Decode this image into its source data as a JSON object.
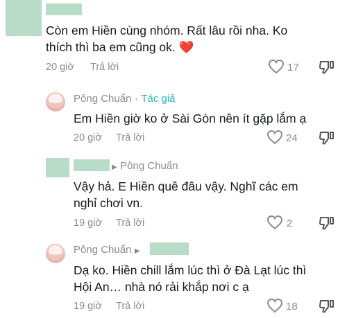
{
  "comments": [
    {
      "text_line1": "Còn em Hiền cùng nhóm. Rất lâu rồi nha. Ko",
      "text_line2": "thích thì ba em cũng ok.",
      "emoji": "❤️",
      "time": "20 giờ",
      "reply_label": "Trả lời",
      "likes": "17"
    },
    {
      "author": "Pông Chuẩn",
      "separator": "·",
      "author_badge": "Tác giả",
      "text_line1": "Em Hiền giờ ko ở Sài Gòn nên ít gặp lắm ạ",
      "time": "20 giờ",
      "reply_label": "Trả lời",
      "likes": "24"
    },
    {
      "reply_to": "Pông Chuẩn",
      "text_line1": "Vậy hả. E Hiền quê đâu vậy. Nghĩ các em",
      "text_line2": "nghỉ chơi vn.",
      "time": "19 giờ",
      "reply_label": "Trả lời",
      "likes": "2"
    },
    {
      "author": "Pông Chuẩn",
      "text_line1": "Dạ ko. Hiền chill lắm lúc thì ở Đà Lạt lúc thì",
      "text_line2": "Hội An… nhà nó rải khắp nơi c ạ",
      "time": "19 giờ",
      "reply_label": "Trả lời",
      "likes": "18"
    }
  ],
  "icons": {
    "like": "heart-outline-icon",
    "dislike": "thumbs-down-icon",
    "reply_arrow": "triangle-right-icon"
  },
  "colors": {
    "text": "#161823",
    "muted": "#8a8b91",
    "author_badge": "#25b5c7",
    "redaction": "#b9dcc8"
  }
}
